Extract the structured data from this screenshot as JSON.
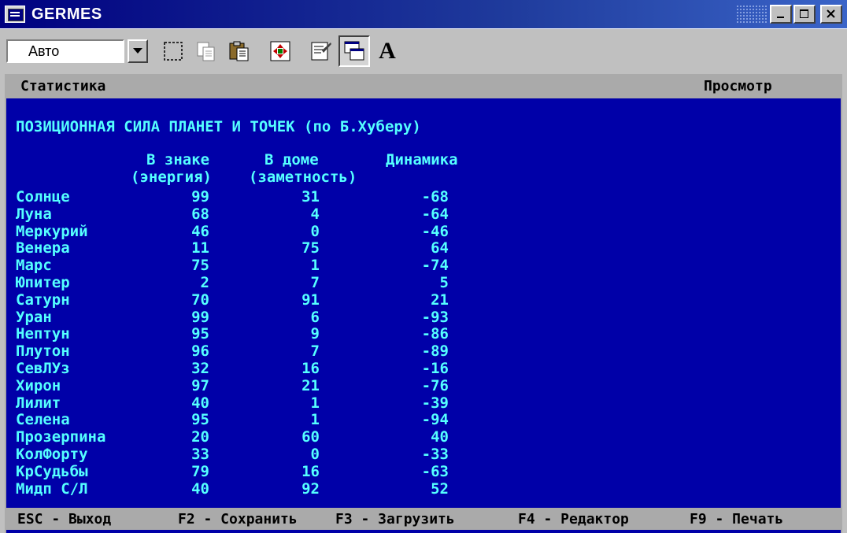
{
  "window": {
    "title": "GERMES",
    "buttons": {
      "minimize": "_",
      "maximize": "□",
      "close": "x"
    }
  },
  "toolbar": {
    "combo_value": "Авто",
    "buttons": [
      {
        "name": "select-icon"
      },
      {
        "name": "copy-icon"
      },
      {
        "name": "paste-icon"
      },
      {
        "name": "fullscreen-icon"
      },
      {
        "name": "properties-icon"
      },
      {
        "name": "background-icon"
      },
      {
        "name": "font-icon",
        "label": "A"
      }
    ]
  },
  "console": {
    "menu_left": "Статистика",
    "menu_right": "Просмотр",
    "heading": "ПОЗИЦИОННАЯ СИЛА ПЛАНЕТ И ТОЧЕК (по Б.Хуберу)",
    "columns": {
      "c1_line1": "В знаке",
      "c1_line2": "(энергия)",
      "c2_line1": "В доме",
      "c2_line2": "(заметность)",
      "c3_line1": "Динамика"
    },
    "rows": [
      {
        "name": "Солнце",
        "sign": "99",
        "house": "31",
        "dyn": "-68"
      },
      {
        "name": "Луна",
        "sign": "68",
        "house": "4",
        "dyn": "-64"
      },
      {
        "name": "Меркурий",
        "sign": "46",
        "house": "0",
        "dyn": "-46"
      },
      {
        "name": "Венера",
        "sign": "11",
        "house": "75",
        "dyn": "64"
      },
      {
        "name": "Марс",
        "sign": "75",
        "house": "1",
        "dyn": "-74"
      },
      {
        "name": "Юпитер",
        "sign": "2",
        "house": "7",
        "dyn": "5"
      },
      {
        "name": "Сатурн",
        "sign": "70",
        "house": "91",
        "dyn": "21"
      },
      {
        "name": "Уран",
        "sign": "99",
        "house": "6",
        "dyn": "-93"
      },
      {
        "name": "Нептун",
        "sign": "95",
        "house": "9",
        "dyn": "-86"
      },
      {
        "name": "Плутон",
        "sign": "96",
        "house": "7",
        "dyn": "-89"
      },
      {
        "name": "СевЛУз",
        "sign": "32",
        "house": "16",
        "dyn": "-16"
      },
      {
        "name": "Хирон",
        "sign": "97",
        "house": "21",
        "dyn": "-76"
      },
      {
        "name": "Лилит",
        "sign": "40",
        "house": "1",
        "dyn": "-39"
      },
      {
        "name": "Селена",
        "sign": "95",
        "house": "1",
        "dyn": "-94"
      },
      {
        "name": "Прозерпина",
        "sign": "20",
        "house": "60",
        "dyn": "40"
      },
      {
        "name": "КолФорту",
        "sign": "33",
        "house": "0",
        "dyn": "-33"
      },
      {
        "name": "КрСудьбы",
        "sign": "79",
        "house": "16",
        "dyn": "-63"
      },
      {
        "name": "Мидп С/Л",
        "sign": "40",
        "house": "92",
        "dyn": "52"
      }
    ],
    "status": {
      "esc": "ESC - Выход",
      "f2": "F2 - Сохранить",
      "f3": "F3 - Загрузить",
      "f4": "F4 - Редактор",
      "f9": "F9 - Печать"
    }
  },
  "colors": {
    "console_bg": "#0000a8",
    "console_text": "#55ffff",
    "bar_bg": "#aaaaaa",
    "title_bg": "#000080"
  }
}
